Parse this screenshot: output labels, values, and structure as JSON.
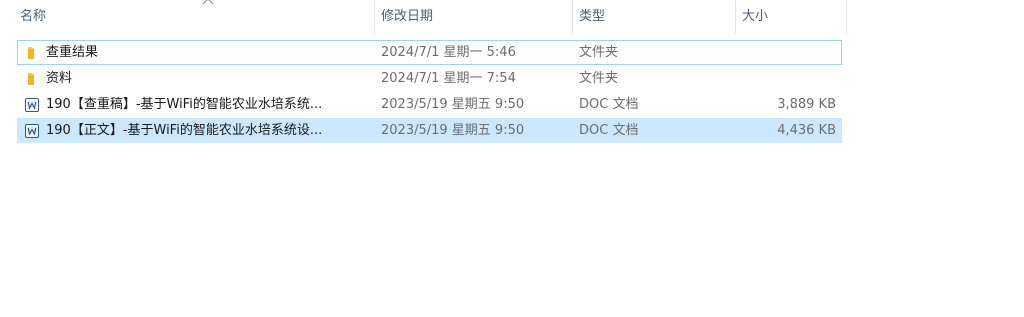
{
  "columns": {
    "name": "名称",
    "date": "修改日期",
    "type": "类型",
    "size": "大小"
  },
  "files": [
    {
      "icon": "folder-icon",
      "name": "查重结果",
      "date": "2024/7/1 星期一 5:46",
      "type": "文件夹",
      "size": ""
    },
    {
      "icon": "folder-icon",
      "name": "资料",
      "date": "2024/7/1 星期一 7:54",
      "type": "文件夹",
      "size": ""
    },
    {
      "icon": "word-doc-icon",
      "name": "190【查重稿】-基于WiFi的智能农业水培系统...",
      "date": "2023/5/19 星期五 9:50",
      "type": "DOC 文档",
      "size": "3,889 KB"
    },
    {
      "icon": "word-doc-icon",
      "name": "190【正文】-基于WiFi的智能农业水培系统设...",
      "date": "2023/5/19 星期五 9:50",
      "type": "DOC 文档",
      "size": "4,436 KB"
    }
  ],
  "colors": {
    "header_text": "#4c607a",
    "selection": "#cce8ff",
    "focus_border": "#99d1ff",
    "folder": "#ffc83d",
    "word": "#2b579a"
  }
}
